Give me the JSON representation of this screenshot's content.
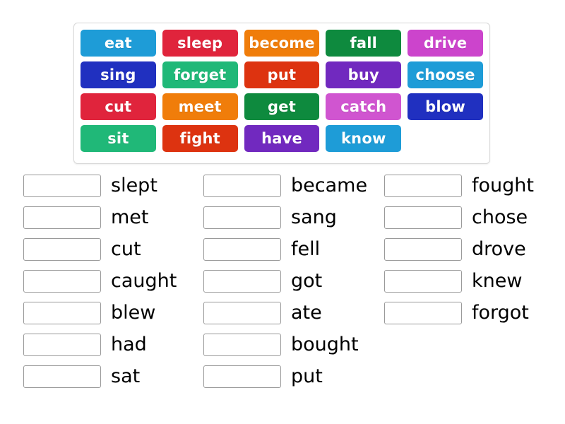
{
  "word_bank": {
    "rows": [
      [
        {
          "label": "eat",
          "color": "#1e9cd7"
        },
        {
          "label": "sleep",
          "color": "#e0243c"
        },
        {
          "label": "become",
          "color": "#f07d0a"
        },
        {
          "label": "fall",
          "color": "#0e8a3e"
        },
        {
          "label": "drive",
          "color": "#cc44cc"
        }
      ],
      [
        {
          "label": "sing",
          "color": "#2030c0"
        },
        {
          "label": "forget",
          "color": "#20b878"
        },
        {
          "label": "put",
          "color": "#dd3310"
        },
        {
          "label": "buy",
          "color": "#7129bf"
        },
        {
          "label": "choose",
          "color": "#1e9cd7"
        }
      ],
      [
        {
          "label": "cut",
          "color": "#e0243c"
        },
        {
          "label": "meet",
          "color": "#f07d0a"
        },
        {
          "label": "get",
          "color": "#0e8a3e"
        },
        {
          "label": "catch",
          "color": "#d055d0"
        },
        {
          "label": "blow",
          "color": "#2030c0"
        }
      ],
      [
        {
          "label": "sit",
          "color": "#20b878"
        },
        {
          "label": "fight",
          "color": "#dd3310"
        },
        {
          "label": "have",
          "color": "#7129bf"
        },
        {
          "label": "know",
          "color": "#1e9cd7"
        },
        {
          "label": "",
          "color": "transparent"
        }
      ]
    ]
  },
  "answers": {
    "columns": [
      {
        "items": [
          {
            "box_value": "",
            "label": "slept"
          },
          {
            "box_value": "",
            "label": "met"
          },
          {
            "box_value": "",
            "label": "cut"
          },
          {
            "box_value": "",
            "label": "caught"
          },
          {
            "box_value": "",
            "label": "blew"
          },
          {
            "box_value": "",
            "label": "had"
          },
          {
            "box_value": "",
            "label": "sat"
          }
        ]
      },
      {
        "items": [
          {
            "box_value": "",
            "label": "became"
          },
          {
            "box_value": "",
            "label": "sang"
          },
          {
            "box_value": "",
            "label": "fell"
          },
          {
            "box_value": "",
            "label": "got"
          },
          {
            "box_value": "",
            "label": "ate"
          },
          {
            "box_value": "",
            "label": "bought"
          },
          {
            "box_value": "",
            "label": "put"
          }
        ]
      },
      {
        "items": [
          {
            "box_value": "",
            "label": "fought"
          },
          {
            "box_value": "",
            "label": "chose"
          },
          {
            "box_value": "",
            "label": "drove"
          },
          {
            "box_value": "",
            "label": "knew"
          },
          {
            "box_value": "",
            "label": "forgot"
          }
        ]
      }
    ]
  }
}
